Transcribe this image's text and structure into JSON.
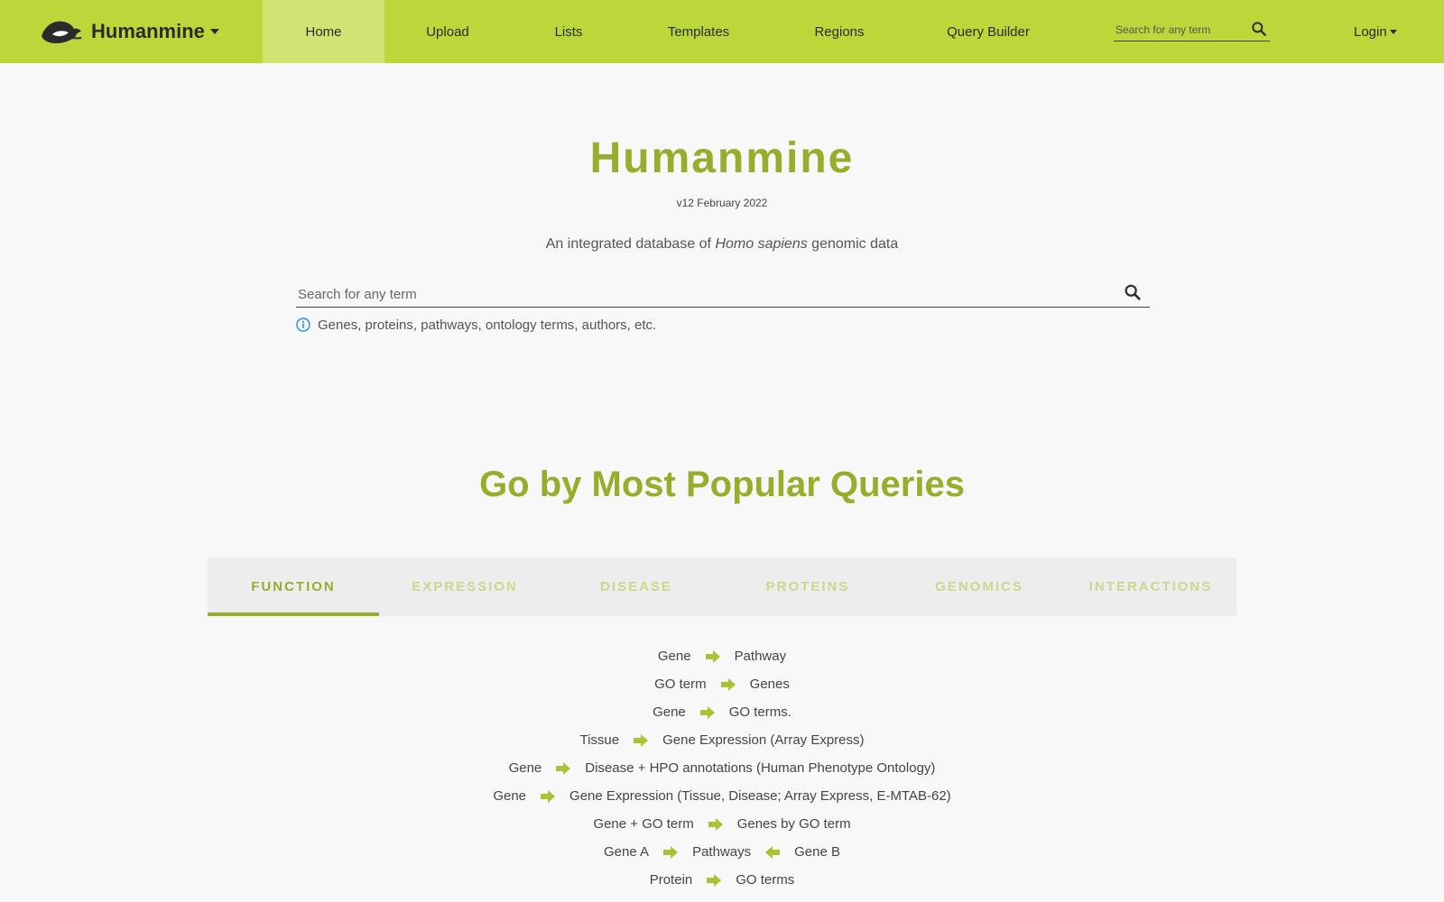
{
  "navbar": {
    "brand": "Humanmine",
    "items": [
      {
        "label": "Home",
        "active": true
      },
      {
        "label": "Upload"
      },
      {
        "label": "Lists"
      },
      {
        "label": "Templates"
      },
      {
        "label": "Regions"
      },
      {
        "label": "Query Builder"
      }
    ],
    "search_placeholder": "Search for any term",
    "login": "Login"
  },
  "hero": {
    "title": "Humanmine",
    "version": "v12 February 2022",
    "tagline_before": "An integrated database of ",
    "tagline_italic": "Homo sapiens",
    "tagline_after": " genomic data",
    "search_placeholder": "Search for any term",
    "hint": "Genes, proteins, pathways, ontology terms, authors, etc."
  },
  "popular": {
    "title": "Go by Most Popular Queries",
    "tabs": [
      "Function",
      "Expression",
      "Disease",
      "Proteins",
      "Genomics",
      "Interactions"
    ],
    "active_tab": "Function",
    "queries": [
      {
        "from": "Gene",
        "to": "Pathway"
      },
      {
        "from": "GO term",
        "to": "Genes"
      },
      {
        "from": "Gene",
        "to": "GO terms."
      },
      {
        "from": "Tissue",
        "to": "Gene Expression (Array Express)"
      },
      {
        "from": "Gene",
        "to": "Disease + HPO annotations (Human Phenotype Ontology)"
      },
      {
        "from": "Gene",
        "to": "Gene Expression (Tissue, Disease; Array Express, E-MTAB-62)"
      },
      {
        "from": "Gene + GO term",
        "to": "Genes by GO term"
      },
      {
        "from": "Gene A",
        "to": "Pathways",
        "back": "Gene B"
      },
      {
        "from": "Protein",
        "to": "GO terms"
      }
    ]
  },
  "colors": {
    "navbar": "#bbd73a",
    "accent": "#97ad2b",
    "arrow": "#a8c334"
  },
  "icons": {
    "logo": "humanmine-logo-icon",
    "search": "search-icon",
    "info": "info-icon",
    "arrow": "arrow-right-icon"
  }
}
